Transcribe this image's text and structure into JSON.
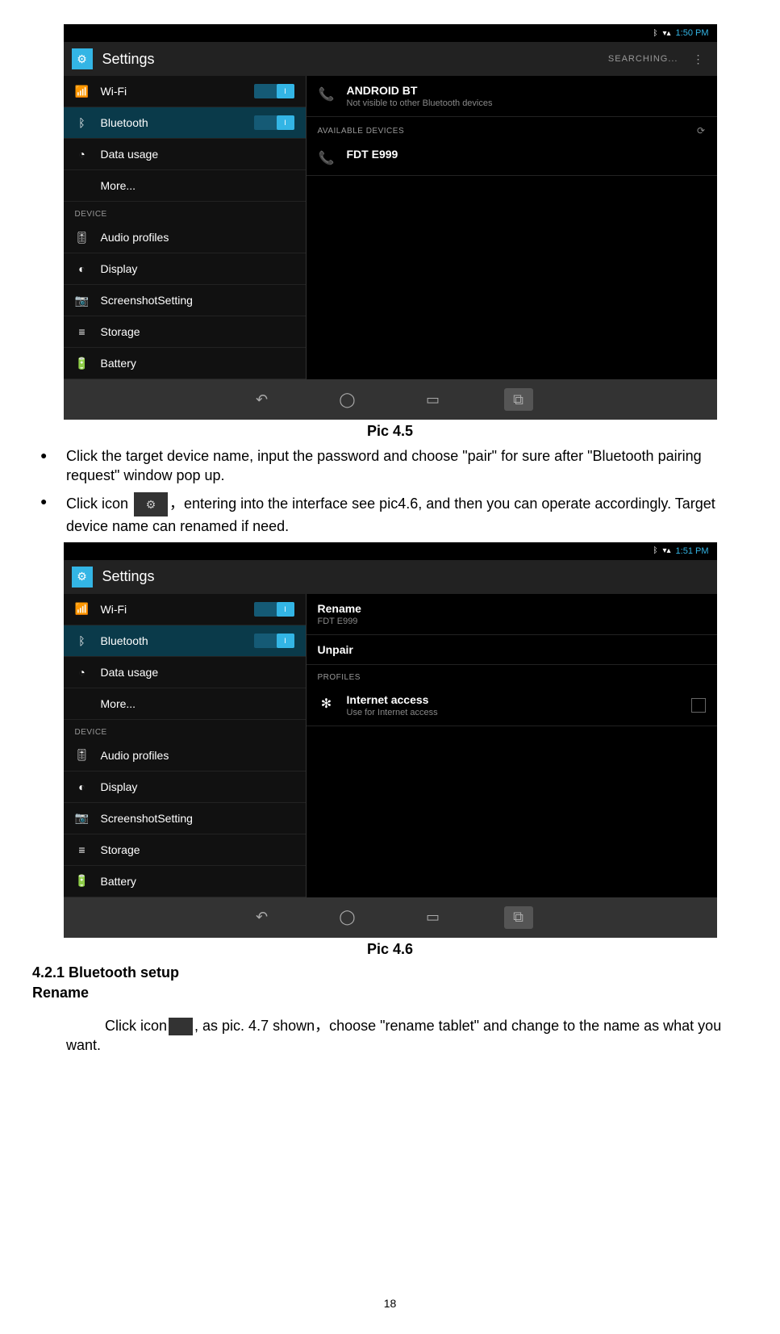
{
  "screenshot1": {
    "status": {
      "time": "1:50 PM",
      "bt_glyph": "ᛒ",
      "signal_glyph": "▾▴"
    },
    "header": {
      "title": "Settings",
      "searching": "SEARCHING...",
      "more": "⋮"
    },
    "sidebar": {
      "wifi": "Wi-Fi",
      "bluetooth": "Bluetooth",
      "data": "Data usage",
      "more": "More...",
      "device_header": "DEVICE",
      "audio": "Audio profiles",
      "display": "Display",
      "screenshot": "ScreenshotSetting",
      "storage": "Storage",
      "battery": "Battery"
    },
    "right": {
      "own_device": "ANDROID BT",
      "own_sub": "Not visible to other Bluetooth devices",
      "avail_header": "AVAILABLE DEVICES",
      "device1": "FDT E999"
    }
  },
  "caption1": "Pic 4.5",
  "bullet1": "Click the target device name, input the password and choose \"pair\" for sure after \"Bluetooth pairing request\" window pop up.",
  "bullet2a": "Click icon ",
  "bullet2b": "，entering into the interface see pic4.6, and then you can operate accordingly. Target device name can renamed if need.",
  "icon_sliders": "⚙",
  "screenshot2": {
    "status": {
      "time": "1:51 PM",
      "bt_glyph": "ᛒ",
      "signal_glyph": "▾▴"
    },
    "header": {
      "title": "Settings",
      "more": "⋮"
    },
    "sidebar": {
      "wifi": "Wi-Fi",
      "bluetooth": "Bluetooth",
      "data": "Data usage",
      "more": "More...",
      "device_header": "DEVICE",
      "audio": "Audio profiles",
      "display": "Display",
      "screenshot": "ScreenshotSetting",
      "storage": "Storage",
      "battery": "Battery"
    },
    "right": {
      "rename": "Rename",
      "rename_sub": "FDT E999",
      "unpair": "Unpair",
      "profiles_header": "PROFILES",
      "internet": "Internet access",
      "internet_sub": "Use for Internet access"
    }
  },
  "caption2": "Pic 4.6",
  "section_num": "4.2.1 Bluetooth setup",
  "section_rename": "Rename",
  "para_a": "Click icon",
  "para_b": ", as pic. 4.7 shown，choose \"rename tablet\" and change to the name as what you want.",
  "icon_menu": "⋮",
  "page_number": "18",
  "glyphs": {
    "wifi": "📶",
    "bt": "ᛒ",
    "data": "◔",
    "sliders": "🎚",
    "display": "◐",
    "camera": "📷",
    "storage": "≡",
    "battery": "🔋",
    "phone": "📞",
    "bt_pair": "✻",
    "back": "↶",
    "home": "◯",
    "recent": "▭",
    "screenshot": "⧉",
    "refresh": "⟳"
  }
}
